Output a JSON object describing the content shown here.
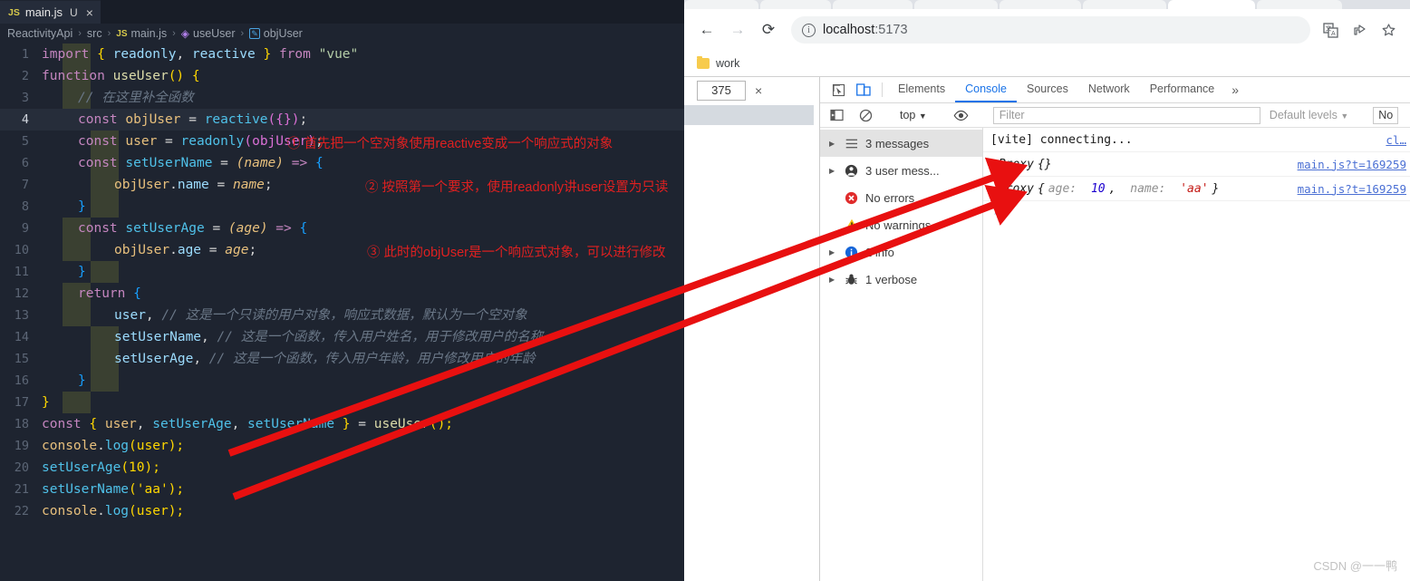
{
  "editor": {
    "tab": {
      "icon": "js-file-icon",
      "badge": "JS",
      "name": "main.js",
      "modified": "U",
      "close": "×"
    },
    "breadcrumb": [
      {
        "label": "ReactivityApi",
        "icon": ""
      },
      {
        "label": "src",
        "icon": ""
      },
      {
        "label": "main.js",
        "icon": "js-icon"
      },
      {
        "label": "useUser",
        "icon": "symbol-method-icon"
      },
      {
        "label": "objUser",
        "icon": "symbol-variable-icon"
      }
    ],
    "breadcrumb_separator": "›",
    "lines": [
      {
        "n": "1"
      },
      {
        "n": "2"
      },
      {
        "n": "3"
      },
      {
        "n": "4"
      },
      {
        "n": "5"
      },
      {
        "n": "6"
      },
      {
        "n": "7"
      },
      {
        "n": "8"
      },
      {
        "n": "9"
      },
      {
        "n": "10"
      },
      {
        "n": "11"
      },
      {
        "n": "12"
      },
      {
        "n": "13"
      },
      {
        "n": "14"
      },
      {
        "n": "15"
      },
      {
        "n": "16"
      },
      {
        "n": "17"
      },
      {
        "n": "18"
      },
      {
        "n": "19"
      },
      {
        "n": "20"
      },
      {
        "n": "21"
      },
      {
        "n": "22"
      }
    ],
    "code": {
      "l1_import": "import",
      "l1_brace1": "{",
      "l1_readonly": "readonly",
      "l1_comma": ",",
      "l1_reactive": "reactive",
      "l1_brace2": "}",
      "l1_from": "from",
      "l1_vue": "\"vue\"",
      "l2_function": "function",
      "l2_name": "useUser",
      "l2_parens": "()",
      "l2_brace": "{",
      "l3_comment": "// 在这里补全函数",
      "l4_const": "const",
      "l4_id": "objUser",
      "l4_eq": "=",
      "l4_call": "reactive",
      "l4_args": "({})",
      "l4_semi": ";",
      "l5_const": "const",
      "l5_id": "user",
      "l5_eq": "=",
      "l5_call": "readonly",
      "l5_args": "(objUser)",
      "l5_semi": ";",
      "l6_const": "const",
      "l6_id": "setUserName",
      "l6_eq": "=",
      "l6_param": "(name)",
      "l6_arrow": "=>",
      "l6_brace": "{",
      "l7_obj": "objUser",
      "l7_dot": ".",
      "l7_prop": "name",
      "l7_eq": "=",
      "l7_val": "name",
      "l7_semi": ";",
      "l8_close": "}",
      "l9_const": "const",
      "l9_id": "setUserAge",
      "l9_eq": "=",
      "l9_param": "(age)",
      "l9_arrow": "=>",
      "l9_brace": "{",
      "l10_obj": "objUser",
      "l10_dot": ".",
      "l10_prop": "age",
      "l10_eq": "=",
      "l10_val": "age",
      "l10_semi": ";",
      "l11_close": "}",
      "l12_return": "return",
      "l12_brace": "{",
      "l13_id": "user",
      "l13_comma": ",",
      "l13_comment": "// 这是一个只读的用户对象，响应式数据，默认为一个空对象",
      "l14_id": "setUserName",
      "l14_comma": ",",
      "l14_comment": "// 这是一个函数，传入用户姓名，用于修改用户的名称",
      "l15_id": "setUserAge",
      "l15_comma": ",",
      "l15_comment": "// 这是一个函数，传入用户年龄，用户修改用户的年龄",
      "l16_close": "}",
      "l17_close": "}",
      "l18_const": "const",
      "l18_open": "{",
      "l18_a": "user",
      "l18_c1": ",",
      "l18_b": "setUserAge",
      "l18_c2": ",",
      "l18_c": "setUserName",
      "l18_close": "}",
      "l18_eq": "=",
      "l18_call": "useUser",
      "l18_tail": "();",
      "l19_console": "console",
      "l19_dot": ".",
      "l19_log": "log",
      "l19_args": "(user);",
      "l20_call": "setUserAge",
      "l20_args": "(10);",
      "l21_call": "setUserName",
      "l21_args": "('aa');",
      "l22_console": "console",
      "l22_dot": ".",
      "l22_log": "log",
      "l22_args": "(user);"
    },
    "annotations": [
      {
        "id": "annot-1",
        "text": "① 首先把一个空对象使用reactive变成一个响应式的对象"
      },
      {
        "id": "annot-2",
        "text": "② 按照第一个要求，使用readonly讲user设置为只读"
      },
      {
        "id": "annot-3",
        "text": "③ 此时的objUser是一个响应式对象，可以进行修改"
      }
    ],
    "colors": {
      "background": "#1e2430",
      "annotation": "#e02020",
      "active_line": "#262d3a"
    }
  },
  "browser": {
    "nav": {
      "back": "←",
      "forward": "→",
      "reload": "⟳"
    },
    "omnibox": {
      "info_icon": "info-icon",
      "url_host": "localhost",
      "url_port": ":5173"
    },
    "toolbar_icons": [
      {
        "name": "translate-icon",
        "glyph": "文A"
      },
      {
        "name": "share-icon",
        "glyph": "↱"
      },
      {
        "name": "bookmark-star-icon",
        "glyph": "☆"
      }
    ],
    "bookmarks": [
      {
        "label": "work",
        "icon": "folder-icon"
      }
    ]
  },
  "devtools": {
    "device": {
      "width_value": "375",
      "close": "×"
    },
    "toolbar_icons": [
      {
        "name": "inspect-element-icon"
      },
      {
        "name": "toggle-device-toolbar-icon"
      }
    ],
    "tabs": [
      {
        "label": "Elements",
        "selected": false
      },
      {
        "label": "Console",
        "selected": true
      },
      {
        "label": "Sources",
        "selected": false
      },
      {
        "label": "Network",
        "selected": false
      },
      {
        "label": "Performance",
        "selected": false
      }
    ],
    "more_tabs": "»",
    "filterbar": {
      "sidebar_toggle": "console-sidebar-icon",
      "clear": "clear-console-icon",
      "context": "top",
      "eye": "live-expression-icon",
      "filter_placeholder": "Filter",
      "levels": "Default levels",
      "issues": "No"
    },
    "sidebar_messages": [
      {
        "label": "3 messages",
        "icon": "list-icon",
        "expandable": true,
        "selected": true
      },
      {
        "label": "3 user mess...",
        "icon": "user-icon",
        "expandable": true,
        "selected": false
      },
      {
        "label": "No errors",
        "icon": "error-icon",
        "expandable": false,
        "selected": false
      },
      {
        "label": "No warnings",
        "icon": "warning-icon",
        "expandable": false,
        "selected": false
      },
      {
        "label": "2 info",
        "icon": "info-icon",
        "expandable": true,
        "selected": false
      },
      {
        "label": "1 verbose",
        "icon": "verbose-bug-icon",
        "expandable": true,
        "selected": false
      }
    ],
    "logs": [
      {
        "type": "text",
        "text": "[vite] connecting...",
        "source": "cl…",
        "expandable": false
      },
      {
        "type": "proxy",
        "name": "Proxy",
        "body": "{}",
        "source": "main.js?t=169259",
        "expandable": true
      },
      {
        "type": "proxy",
        "name": "Proxy",
        "open": "{",
        "key1": "age:",
        "num1": "10",
        "sep": ",",
        "key2": "name:",
        "str2": "'aa'",
        "close": "}",
        "source": "main.js?t=169259",
        "expandable": true
      }
    ],
    "prompt": "›"
  },
  "watermark": "CSDN @一一鸭"
}
